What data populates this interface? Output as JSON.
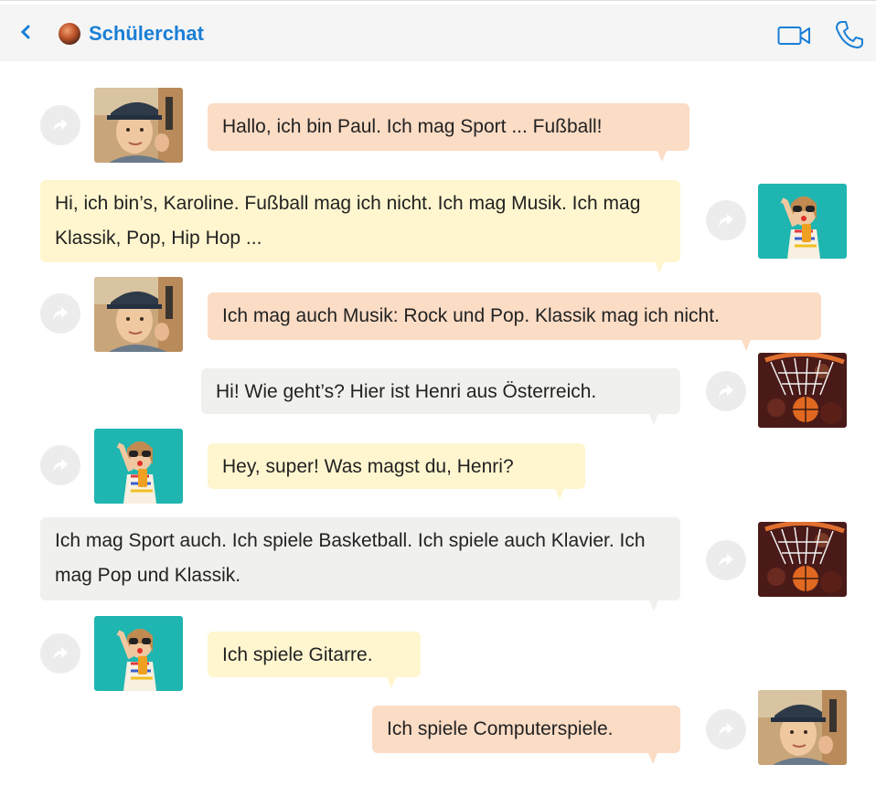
{
  "header": {
    "back_icon": "chevron-left-icon",
    "title": "Schülerchat",
    "video_icon": "video-camera-icon",
    "call_icon": "phone-icon",
    "accent_color": "#1a7fd6"
  },
  "messages": [
    {
      "sender": "Paul",
      "side": "left",
      "color": "#fbdcc5",
      "text": "Hallo, ich bin Paul. Ich mag Sport ... Fußball!"
    },
    {
      "sender": "Karoline",
      "side": "right",
      "color": "#fff6cf",
      "text": "Hi, ich bin’s, Karoline. Fußball mag ich nicht. Ich mag Musik. Ich mag Klassik, Pop, Hip Hop ..."
    },
    {
      "sender": "Paul",
      "side": "left",
      "color": "#fbdcc5",
      "text": "Ich mag auch Musik: Rock und Pop. Klassik mag ich nicht."
    },
    {
      "sender": "Henri",
      "side": "right",
      "color": "#f0f0ee",
      "text": "Hi! Wie geht’s? Hier ist Henri aus Österreich."
    },
    {
      "sender": "Karoline",
      "side": "left",
      "color": "#fff6cf",
      "text": "Hey, super! Was magst du, Henri?"
    },
    {
      "sender": "Henri",
      "side": "right",
      "color": "#f0f0ee",
      "text": "Ich mag Sport auch. Ich spiele Basketball. Ich spiele auch Klavier. Ich mag Pop und Klassik."
    },
    {
      "sender": "Karoline",
      "side": "left",
      "color": "#fff6cf",
      "text": "Ich spiele Gitarre."
    },
    {
      "sender": "Paul",
      "side": "right",
      "color": "#fbdcc5",
      "text": "Ich spiele Computerspiele."
    }
  ]
}
